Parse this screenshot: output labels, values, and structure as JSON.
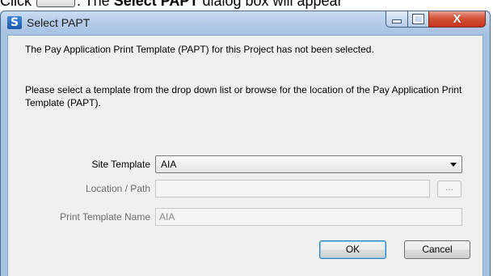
{
  "doc": {
    "prefix": "Click",
    "suffix": ". The",
    "bold": "Select PAPT",
    "tail": "dialog box will appear"
  },
  "window": {
    "title": "Select PAPT",
    "icon": "S",
    "close_glyph": "X"
  },
  "dialog": {
    "message1": "The Pay Application Print Template (PAPT) for this Project has not been selected.",
    "message2": "Please select a template from the drop down list or browse for the location of the Pay Application Print Template (PAPT).",
    "site_template_label": "Site Template",
    "site_template_value": "AIA",
    "location_label": "Location / Path",
    "location_value": "",
    "browse_label": "...",
    "print_name_label": "Print Template Name",
    "print_name_value": "AIA",
    "ok_label": "OK",
    "cancel_label": "Cancel"
  }
}
